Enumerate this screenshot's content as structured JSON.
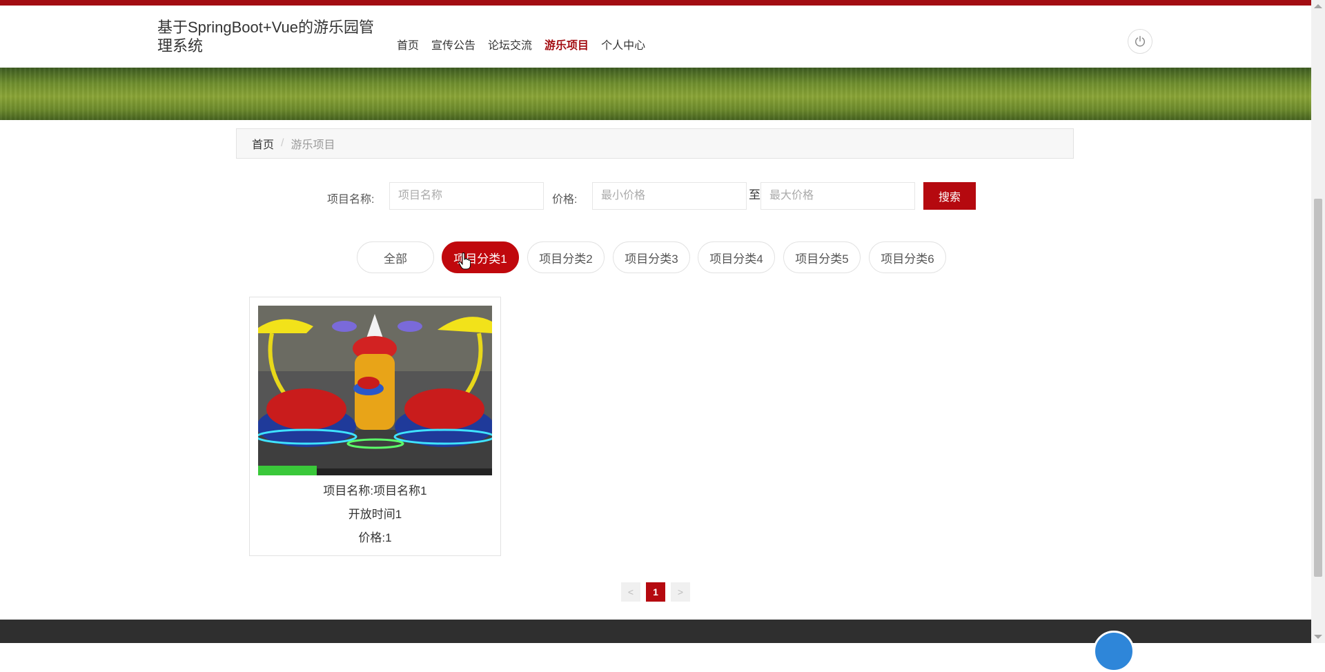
{
  "header": {
    "title": "基于SpringBoot+Vue的游乐园管理系统",
    "nav": [
      {
        "label": "首页",
        "active": false
      },
      {
        "label": "宣传公告",
        "active": false
      },
      {
        "label": "论坛交流",
        "active": false
      },
      {
        "label": "游乐项目",
        "active": true
      },
      {
        "label": "个人中心",
        "active": false
      }
    ],
    "power_icon": "power-icon"
  },
  "breadcrumb": {
    "home": "首页",
    "separator": "/",
    "current": "游乐项目"
  },
  "search": {
    "name_label": "项目名称:",
    "name_placeholder": "项目名称",
    "price_label": "价格:",
    "min_placeholder": "最小价格",
    "to_text": "至",
    "max_placeholder": "最大价格",
    "button_label": "搜索"
  },
  "categories": [
    {
      "label": "全部",
      "active": false
    },
    {
      "label": "项目分类1",
      "active": true
    },
    {
      "label": "项目分类2",
      "active": false
    },
    {
      "label": "项目分类3",
      "active": false
    },
    {
      "label": "项目分类4",
      "active": false
    },
    {
      "label": "项目分类5",
      "active": false
    },
    {
      "label": "项目分类6",
      "active": false
    }
  ],
  "items": [
    {
      "name_line": "项目名称:项目名称1",
      "time_line": "开放时间1",
      "price_line": "价格:1"
    }
  ],
  "pagination": {
    "prev": "<",
    "current": "1",
    "next": ">"
  },
  "colors": {
    "accent": "#b5090f",
    "top_line": "#a30d12",
    "footer": "#2f2f2f"
  }
}
